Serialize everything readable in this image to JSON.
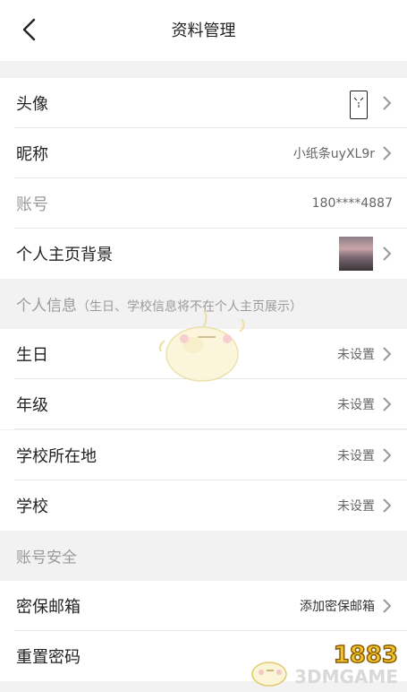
{
  "header": {
    "title": "资料管理"
  },
  "rows": {
    "avatar": {
      "label": "头像"
    },
    "nickname": {
      "label": "昵称",
      "value": "小纸条uyXL9r"
    },
    "account": {
      "label": "账号",
      "value": "180****4887"
    },
    "background": {
      "label": "个人主页背景"
    },
    "birthday": {
      "label": "生日",
      "value": "未设置"
    },
    "grade": {
      "label": "年级",
      "value": "未设置"
    },
    "school_location": {
      "label": "学校所在地",
      "value": "未设置"
    },
    "school": {
      "label": "学校",
      "value": "未设置"
    },
    "security_email": {
      "label": "密保邮箱",
      "value": "添加密保邮箱"
    },
    "reset_password": {
      "label": "重置密码"
    }
  },
  "sections": {
    "personal_info": {
      "title": "个人信息",
      "subtitle": "（生日、学校信息将不在个人主页展示）"
    },
    "account_security": {
      "title": "账号安全"
    }
  },
  "watermark": {
    "text": "3DMGAME",
    "number": "1883"
  },
  "colors": {
    "background": "#f2f2f2",
    "row": "#ffffff",
    "divider": "#e6e6e6",
    "muted_text": "#9a9a9a"
  }
}
